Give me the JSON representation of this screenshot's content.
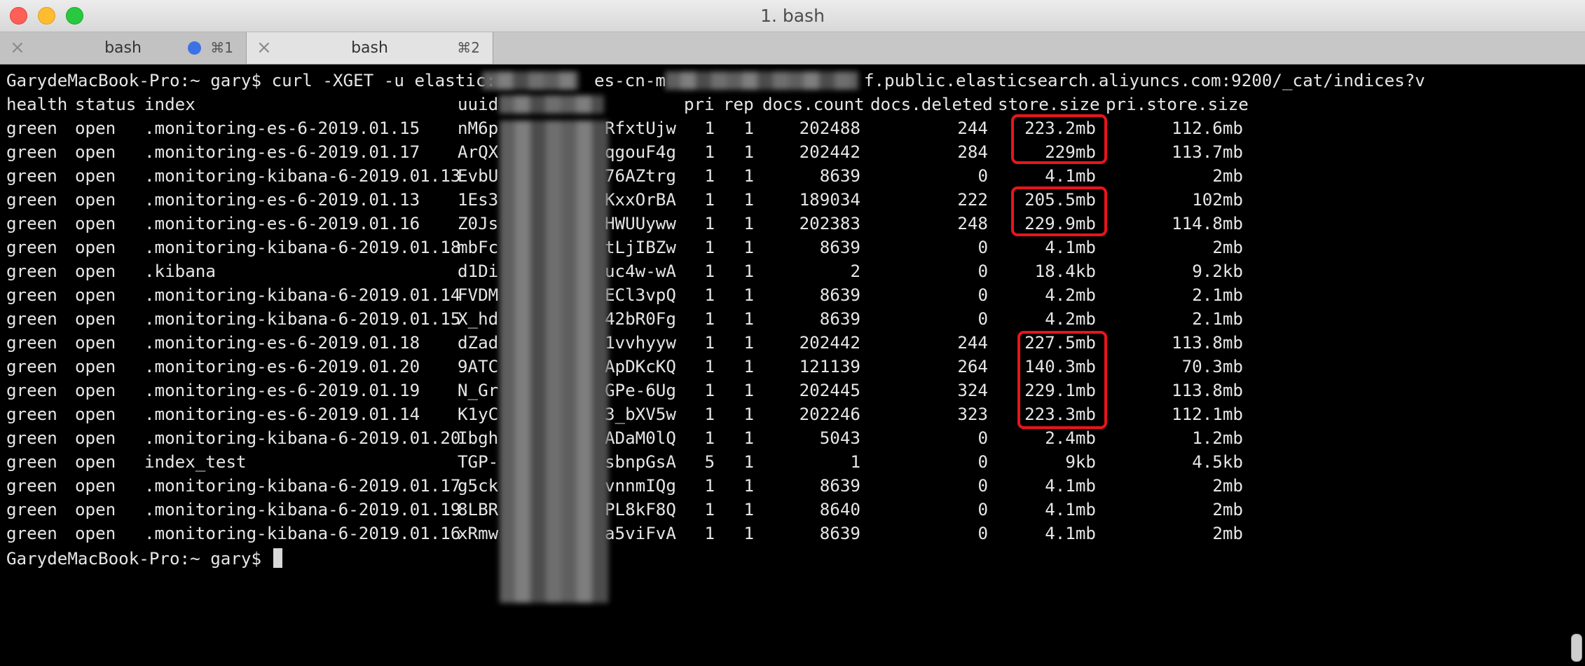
{
  "window": {
    "title": "1. bash",
    "controls": [
      "close",
      "minimize",
      "maximize"
    ]
  },
  "tabs": [
    {
      "close_glyph": "×",
      "label": "bash",
      "indicator": "blue-dot",
      "indicator_color": "#3d72e6",
      "shortcut": "⌘1"
    },
    {
      "close_glyph": "×",
      "label": "bash",
      "shortcut": "⌘2",
      "active": true
    }
  ],
  "terminal": {
    "command": {
      "prompt": "GarydeMacBook-Pro:~ gary$",
      "part1": "curl -XGET -u elastic:",
      "part2": "es-cn-m",
      "part3": "f.public.elasticsearch.aliyuncs.com:9200/_cat/indices?v"
    },
    "headers": {
      "health": "health",
      "status": "status",
      "index": "index",
      "uuid": "uuid",
      "pri": "pri",
      "rep": "rep",
      "docs_count": "docs.count",
      "docs_deleted": "docs.deleted",
      "store_size": "store.size",
      "pri_store_size": "pri.store.size"
    },
    "rows": [
      {
        "health": "green",
        "status": "open",
        "index": ".monitoring-es-6-2019.01.15",
        "uuid_start": "nM6p",
        "uuid_end": "RfxtUjw",
        "pri": "1",
        "rep": "1",
        "docs_count": "202488",
        "docs_deleted": "244",
        "store_size": "223.2mb",
        "pri_store_size": "112.6mb"
      },
      {
        "health": "green",
        "status": "open",
        "index": ".monitoring-es-6-2019.01.17",
        "uuid_start": "ArQX",
        "uuid_end": "qgouF4g",
        "pri": "1",
        "rep": "1",
        "docs_count": "202442",
        "docs_deleted": "284",
        "store_size": "229mb",
        "pri_store_size": "113.7mb"
      },
      {
        "health": "green",
        "status": "open",
        "index": ".monitoring-kibana-6-2019.01.13",
        "uuid_start": "EvbU",
        "uuid_end": "76AZtrg",
        "pri": "1",
        "rep": "1",
        "docs_count": "8639",
        "docs_deleted": "0",
        "store_size": "4.1mb",
        "pri_store_size": "2mb"
      },
      {
        "health": "green",
        "status": "open",
        "index": ".monitoring-es-6-2019.01.13",
        "uuid_start": "1Es3",
        "uuid_end": "KxxOrBA",
        "pri": "1",
        "rep": "1",
        "docs_count": "189034",
        "docs_deleted": "222",
        "store_size": "205.5mb",
        "pri_store_size": "102mb"
      },
      {
        "health": "green",
        "status": "open",
        "index": ".monitoring-es-6-2019.01.16",
        "uuid_start": "Z0Js",
        "uuid_end": "HWUUyww",
        "pri": "1",
        "rep": "1",
        "docs_count": "202383",
        "docs_deleted": "248",
        "store_size": "229.9mb",
        "pri_store_size": "114.8mb"
      },
      {
        "health": "green",
        "status": "open",
        "index": ".monitoring-kibana-6-2019.01.18",
        "uuid_start": "mbFc",
        "uuid_end": "tLjIBZw",
        "pri": "1",
        "rep": "1",
        "docs_count": "8639",
        "docs_deleted": "0",
        "store_size": "4.1mb",
        "pri_store_size": "2mb"
      },
      {
        "health": "green",
        "status": "open",
        "index": ".kibana",
        "uuid_start": "d1Di",
        "uuid_end": "uc4w-wA",
        "pri": "1",
        "rep": "1",
        "docs_count": "2",
        "docs_deleted": "0",
        "store_size": "18.4kb",
        "pri_store_size": "9.2kb"
      },
      {
        "health": "green",
        "status": "open",
        "index": ".monitoring-kibana-6-2019.01.14",
        "uuid_start": "FVDM",
        "uuid_end": "ECl3vpQ",
        "pri": "1",
        "rep": "1",
        "docs_count": "8639",
        "docs_deleted": "0",
        "store_size": "4.2mb",
        "pri_store_size": "2.1mb"
      },
      {
        "health": "green",
        "status": "open",
        "index": ".monitoring-kibana-6-2019.01.15",
        "uuid_start": "X_hd",
        "uuid_end": "42bR0Fg",
        "pri": "1",
        "rep": "1",
        "docs_count": "8639",
        "docs_deleted": "0",
        "store_size": "4.2mb",
        "pri_store_size": "2.1mb"
      },
      {
        "health": "green",
        "status": "open",
        "index": ".monitoring-es-6-2019.01.18",
        "uuid_start": "dZad",
        "uuid_end": "1vvhyyw",
        "pri": "1",
        "rep": "1",
        "docs_count": "202442",
        "docs_deleted": "244",
        "store_size": "227.5mb",
        "pri_store_size": "113.8mb"
      },
      {
        "health": "green",
        "status": "open",
        "index": ".monitoring-es-6-2019.01.20",
        "uuid_start": "9ATC",
        "uuid_end": "ApDKcKQ",
        "pri": "1",
        "rep": "1",
        "docs_count": "121139",
        "docs_deleted": "264",
        "store_size": "140.3mb",
        "pri_store_size": "70.3mb"
      },
      {
        "health": "green",
        "status": "open",
        "index": ".monitoring-es-6-2019.01.19",
        "uuid_start": "N_Gr",
        "uuid_end": "GPe-6Ug",
        "pri": "1",
        "rep": "1",
        "docs_count": "202445",
        "docs_deleted": "324",
        "store_size": "229.1mb",
        "pri_store_size": "113.8mb"
      },
      {
        "health": "green",
        "status": "open",
        "index": ".monitoring-es-6-2019.01.14",
        "uuid_start": "K1yC",
        "uuid_end": "3_bXV5w",
        "pri": "1",
        "rep": "1",
        "docs_count": "202246",
        "docs_deleted": "323",
        "store_size": "223.3mb",
        "pri_store_size": "112.1mb"
      },
      {
        "health": "green",
        "status": "open",
        "index": ".monitoring-kibana-6-2019.01.20",
        "uuid_start": "Ibgh",
        "uuid_end": "ADaM0lQ",
        "pri": "1",
        "rep": "1",
        "docs_count": "5043",
        "docs_deleted": "0",
        "store_size": "2.4mb",
        "pri_store_size": "1.2mb"
      },
      {
        "health": "green",
        "status": "open",
        "index": "index_test",
        "uuid_start": "TGP-",
        "uuid_end": "sbnpGsA",
        "pri": "5",
        "rep": "1",
        "docs_count": "1",
        "docs_deleted": "0",
        "store_size": "9kb",
        "pri_store_size": "4.5kb"
      },
      {
        "health": "green",
        "status": "open",
        "index": ".monitoring-kibana-6-2019.01.17",
        "uuid_start": "g5ck",
        "uuid_end": "vnnmIQg",
        "pri": "1",
        "rep": "1",
        "docs_count": "8639",
        "docs_deleted": "0",
        "store_size": "4.1mb",
        "pri_store_size": "2mb"
      },
      {
        "health": "green",
        "status": "open",
        "index": ".monitoring-kibana-6-2019.01.19",
        "uuid_start": "8LBR",
        "uuid_end": "PL8kF8Q",
        "pri": "1",
        "rep": "1",
        "docs_count": "8640",
        "docs_deleted": "0",
        "store_size": "4.1mb",
        "pri_store_size": "2mb"
      },
      {
        "health": "green",
        "status": "open",
        "index": ".monitoring-kibana-6-2019.01.16",
        "uuid_start": "xRmw",
        "uuid_end": "a5viFvA",
        "pri": "1",
        "rep": "1",
        "docs_count": "8639",
        "docs_deleted": "0",
        "store_size": "4.1mb",
        "pri_store_size": "2mb"
      }
    ],
    "final_prompt": "GarydeMacBook-Pro:~ gary$",
    "highlight_color": "#e8141d"
  }
}
